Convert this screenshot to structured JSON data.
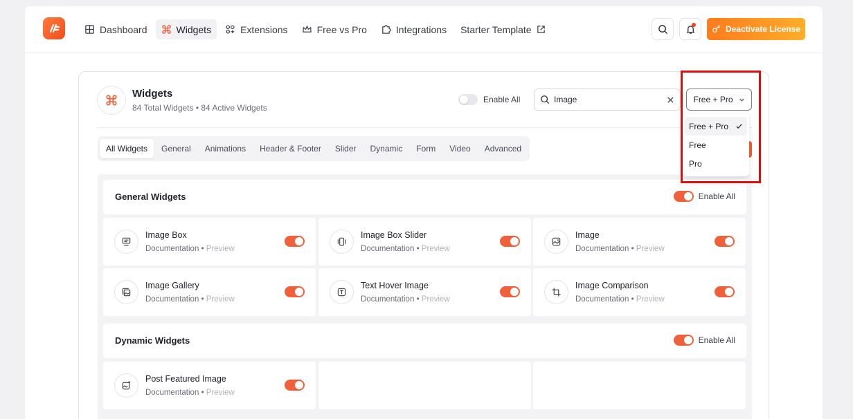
{
  "nav": {
    "items": [
      {
        "label": "Dashboard",
        "icon": "grid-icon",
        "active": false
      },
      {
        "label": "Widgets",
        "icon": "command-icon",
        "active": true
      },
      {
        "label": "Extensions",
        "icon": "extensions-icon",
        "active": false
      },
      {
        "label": "Free vs Pro",
        "icon": "crown-icon",
        "active": false
      },
      {
        "label": "Integrations",
        "icon": "puzzle-icon",
        "active": false
      },
      {
        "label": "Starter Template",
        "icon": "external-link-icon",
        "active": false
      }
    ],
    "deactivate_label": "Deactivate License"
  },
  "panel": {
    "title": "Widgets",
    "subtitle": "84 Total Widgets • 84 Active Widgets",
    "enable_all_label": "Enable All",
    "search_value": "Image",
    "filter_value": "Free + Pro"
  },
  "tabs": [
    "All Widgets",
    "General",
    "Animations",
    "Header & Footer",
    "Slider",
    "Dynamic",
    "Form",
    "Video",
    "Advanced"
  ],
  "sections": {
    "general": {
      "title": "General Widgets",
      "enable_all_label": "Enable All",
      "cards": [
        {
          "name": "Image Box",
          "doc": "Documentation",
          "preview": "Preview",
          "icon": "image-box-icon"
        },
        {
          "name": "Image Box Slider",
          "doc": "Documentation",
          "preview": "Preview",
          "icon": "slider-icon"
        },
        {
          "name": "Image",
          "doc": "Documentation",
          "preview": "Preview",
          "icon": "image-icon"
        },
        {
          "name": "Image Gallery",
          "doc": "Documentation",
          "preview": "Preview",
          "icon": "gallery-icon"
        },
        {
          "name": "Text Hover Image",
          "doc": "Documentation",
          "preview": "Preview",
          "icon": "text-icon"
        },
        {
          "name": "Image Comparison",
          "doc": "Documentation",
          "preview": "Preview",
          "icon": "crop-icon"
        }
      ]
    },
    "dynamic": {
      "title": "Dynamic Widgets",
      "enable_all_label": "Enable All",
      "cards": [
        {
          "name": "Post Featured Image",
          "doc": "Documentation",
          "preview": "Preview",
          "icon": "featured-image-icon"
        }
      ]
    }
  },
  "dropdown": {
    "options": [
      "Free + Pro",
      "Free",
      "Pro"
    ],
    "selected": "Free + Pro"
  },
  "separator": "•",
  "colors": {
    "accent": "#f0603a",
    "highlight": "#e00d0d"
  }
}
